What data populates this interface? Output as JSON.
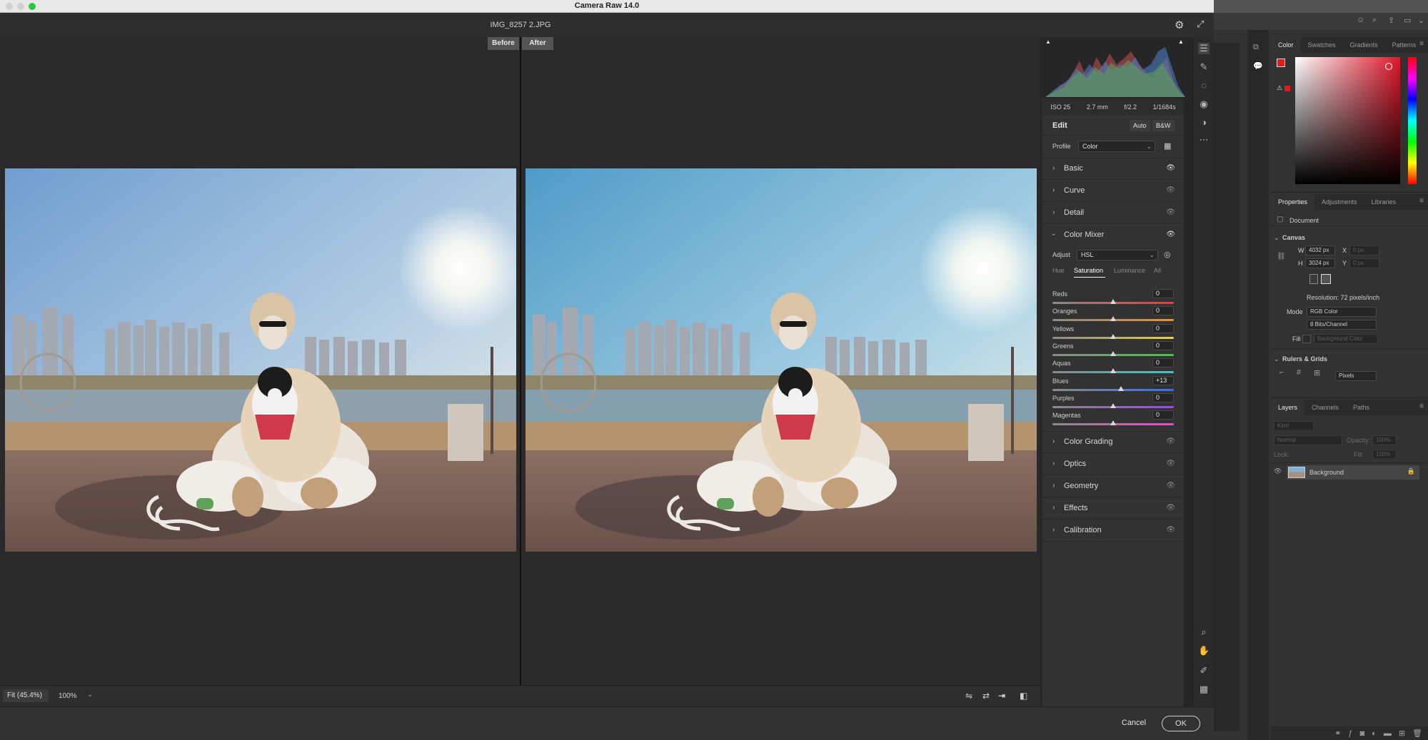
{
  "window": {
    "title": "Camera Raw 14.0",
    "filename": "IMG_8257 2.JPG"
  },
  "view": {
    "before_label": "Before",
    "after_label": "After",
    "zoom_fit": "Fit (45.4%)",
    "zoom_value": "100%"
  },
  "exif": {
    "iso": "ISO 25",
    "focal": "2.7 mm",
    "aperture": "f/2.2",
    "shutter": "1/1684s"
  },
  "edit": {
    "title": "Edit",
    "auto_label": "Auto",
    "bw_label": "B&W",
    "profile_label": "Profile",
    "profile_value": "Color"
  },
  "sections": {
    "basic": "Basic",
    "curve": "Curve",
    "detail": "Detail",
    "color_mixer": "Color Mixer",
    "color_grading": "Color Grading",
    "optics": "Optics",
    "geometry": "Geometry",
    "effects": "Effects",
    "calibration": "Calibration"
  },
  "color_mixer": {
    "adjust_label": "Adjust",
    "adjust_value": "HSL",
    "tabs": [
      "Hue",
      "Saturation",
      "Luminance",
      "All"
    ],
    "active_tab": "Saturation",
    "sliders": [
      {
        "name": "Reds",
        "value": "0",
        "position": 0.5
      },
      {
        "name": "Oranges",
        "value": "0",
        "position": 0.5
      },
      {
        "name": "Yellows",
        "value": "0",
        "position": 0.5
      },
      {
        "name": "Greens",
        "value": "0",
        "position": 0.5
      },
      {
        "name": "Aquas",
        "value": "0",
        "position": 0.5
      },
      {
        "name": "Blues",
        "value": "+13",
        "position": 0.565
      },
      {
        "name": "Purples",
        "value": "0",
        "position": 0.5
      },
      {
        "name": "Magentas",
        "value": "0",
        "position": 0.5
      }
    ]
  },
  "footer": {
    "cancel_label": "Cancel",
    "ok_label": "OK"
  },
  "photoshop": {
    "color_tabs": [
      "Color",
      "Swatches",
      "Gradients",
      "Patterns"
    ],
    "properties_tabs": [
      "Properties",
      "Adjustments",
      "Libraries"
    ],
    "document_label": "Document",
    "canvas_label": "Canvas",
    "w_label": "W",
    "w_value": "4032 px",
    "h_label": "H",
    "h_value": "3024 px",
    "x_label": "X",
    "x_value": "0 px",
    "y_label": "Y",
    "y_value": "0 px",
    "resolution": "Resolution: 72 pixels/inch",
    "mode_label": "Mode",
    "mode_value": "RGB Color",
    "bits_value": "8 Bits/Channel",
    "fill_label": "Fill",
    "fill_value": "Background Color",
    "rulers_label": "Rulers & Grids",
    "units_value": "Pixels",
    "layers_tabs": [
      "Layers",
      "Channels",
      "Paths"
    ],
    "kind_placeholder": "Kind",
    "blend_mode": "Normal",
    "opacity_label": "Opacity:",
    "opacity_value": "100%",
    "lock_label": "Lock:",
    "fill2_label": "Fill:",
    "fill2_value": "100%",
    "layer_name": "Background"
  },
  "colors": {
    "accent": "#2d8ceb",
    "foreground_swatch": "#e01b1b"
  }
}
